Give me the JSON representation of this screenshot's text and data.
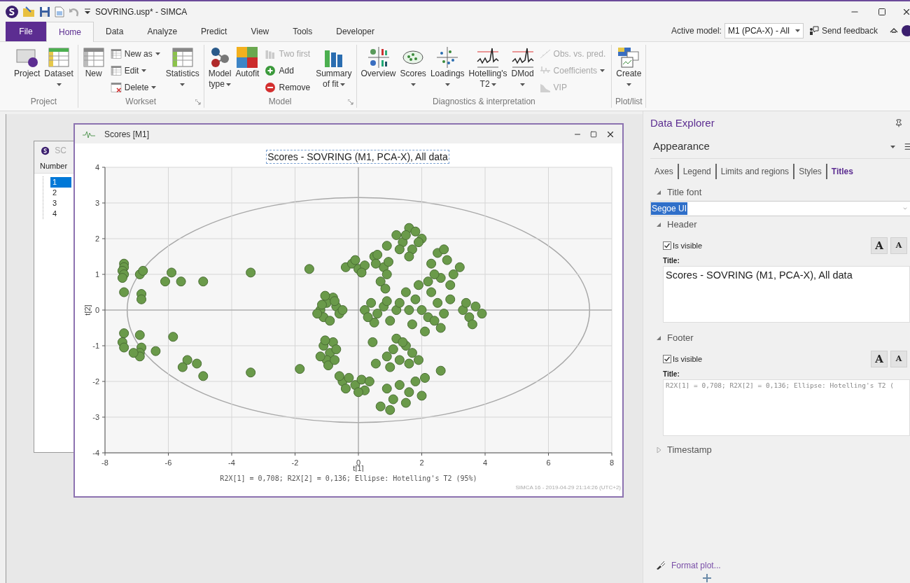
{
  "title_bar": {
    "title": "SOVRING.usp* - SIMCA"
  },
  "ribbon_tabs": [
    {
      "label": "File",
      "kind": "file",
      "selected": false
    },
    {
      "label": "Home",
      "kind": "tab",
      "selected": true
    },
    {
      "label": "Data",
      "kind": "tab",
      "selected": false
    },
    {
      "label": "Analyze",
      "kind": "tab",
      "selected": false
    },
    {
      "label": "Predict",
      "kind": "tab",
      "selected": false
    },
    {
      "label": "View",
      "kind": "tab",
      "selected": false
    },
    {
      "label": "Tools",
      "kind": "tab",
      "selected": false
    },
    {
      "label": "Developer",
      "kind": "tab",
      "selected": false
    }
  ],
  "active_model": {
    "label": "Active model:",
    "value": "M1 (PCA-X) - All"
  },
  "send_feedback": "Send feedback",
  "ribbon_groups": [
    {
      "label": "Project",
      "launcher": false,
      "items": [
        {
          "kind": "large",
          "lines": [
            "Project"
          ],
          "dropdown": false,
          "disabled": false
        },
        {
          "kind": "large",
          "lines": [
            "Dataset"
          ],
          "dropdown": true,
          "disabled": false
        }
      ]
    },
    {
      "label": "Workset",
      "launcher": true,
      "items": [
        {
          "kind": "large",
          "lines": [
            "New"
          ],
          "dropdown": false,
          "disabled": false
        },
        {
          "kind": "small",
          "lines": [
            "New as"
          ],
          "dropdown": true,
          "disabled": false
        },
        {
          "kind": "small",
          "lines": [
            "Edit"
          ],
          "dropdown": true,
          "disabled": false
        },
        {
          "kind": "small",
          "lines": [
            "Delete"
          ],
          "dropdown": true,
          "disabled": false
        },
        {
          "kind": "large",
          "lines": [
            "Statistics"
          ],
          "dropdown": true,
          "disabled": false
        }
      ]
    },
    {
      "label": "Model",
      "launcher": true,
      "items": [
        {
          "kind": "large",
          "lines": [
            "Model",
            "type"
          ],
          "dropdown": true,
          "disabled": false
        },
        {
          "kind": "large",
          "lines": [
            "Autofit"
          ],
          "dropdown": false,
          "disabled": false
        },
        {
          "kind": "small",
          "lines": [
            "Two first"
          ],
          "dropdown": false,
          "disabled": true
        },
        {
          "kind": "small",
          "lines": [
            "Add"
          ],
          "dropdown": false,
          "disabled": false
        },
        {
          "kind": "small",
          "lines": [
            "Remove"
          ],
          "dropdown": false,
          "disabled": false
        },
        {
          "kind": "large",
          "lines": [
            "Summary",
            "of fit"
          ],
          "dropdown": true,
          "disabled": false
        }
      ]
    },
    {
      "label": "Diagnostics & interpretation",
      "launcher": false,
      "items": [
        {
          "kind": "large",
          "lines": [
            "Overview"
          ],
          "dropdown": false,
          "disabled": false
        },
        {
          "kind": "large",
          "lines": [
            "Scores"
          ],
          "dropdown": true,
          "disabled": false
        },
        {
          "kind": "large",
          "lines": [
            "Loadings"
          ],
          "dropdown": true,
          "disabled": false
        },
        {
          "kind": "large",
          "lines": [
            "Hotelling's",
            "T2"
          ],
          "dropdown": true,
          "disabled": false
        },
        {
          "kind": "large",
          "lines": [
            "DMod"
          ],
          "dropdown": true,
          "disabled": false
        },
        {
          "kind": "small",
          "lines": [
            "Obs. vs. pred."
          ],
          "dropdown": false,
          "disabled": true
        },
        {
          "kind": "small",
          "lines": [
            "Coefficients"
          ],
          "dropdown": true,
          "disabled": true
        },
        {
          "kind": "small",
          "lines": [
            "VIP"
          ],
          "dropdown": false,
          "disabled": true
        }
      ]
    },
    {
      "label": "Plot/list",
      "launcher": false,
      "items": [
        {
          "kind": "large",
          "lines": [
            "Create"
          ],
          "dropdown": true,
          "disabled": false
        }
      ]
    }
  ],
  "workset_window": {
    "title": "SC",
    "column": "Number",
    "rows": [
      {
        "label": "1",
        "selected": true
      },
      {
        "label": "2",
        "selected": false
      },
      {
        "label": "3",
        "selected": false
      },
      {
        "label": "4",
        "selected": false
      }
    ]
  },
  "scores_window": {
    "title": "Scores [M1]",
    "chart_data": {
      "type": "scatter",
      "grid": true,
      "title": "Scores - SOVRING (M1, PCA-X), All data",
      "xlabel": "t[1]",
      "ylabel": "t[2]",
      "xlim": [
        -8,
        8
      ],
      "ylim": [
        -4,
        4
      ],
      "xticks": [
        -8,
        -6,
        -4,
        -2,
        0,
        2,
        4,
        6,
        8
      ],
      "yticks": [
        -4,
        -3,
        -2,
        -1,
        0,
        1,
        2,
        3,
        4
      ],
      "x": [
        -7.4,
        -7.4,
        -7.45,
        -7.4,
        -7.45,
        -7.4,
        -7.4,
        -7.45,
        -7.4,
        -6.9,
        -6.8,
        -6.85,
        -6.85,
        -6.9,
        -6.85,
        -6.9,
        -6.9,
        -7.1,
        -6.4,
        -6.1,
        -5.9,
        -5.6,
        -4.9,
        -5.85,
        -5.4,
        -5.55,
        -5.1,
        -4.9,
        -3.4,
        -3.4,
        -1.55,
        -1.85,
        -1.2,
        -1.1,
        -0.8,
        -1.0,
        -0.7,
        -1.3,
        -0.9,
        -0.75,
        -1.05,
        -0.6,
        -1.15,
        -1.1,
        -0.9,
        -1.0,
        -0.8,
        -1.2,
        -0.7,
        -0.95,
        -0.75,
        -1.05,
        -0.5,
        -0.3,
        -0.1,
        0.1,
        -0.4,
        0.2,
        0.35,
        -0.6,
        0.0,
        -0.4,
        -0.2,
        0.0,
        0.2,
        0.5,
        0.8,
        0.9,
        0.7,
        0.85,
        0.55,
        -0.1,
        0.6,
        0.95,
        0.1,
        0.2,
        0.4,
        0.6,
        0.8,
        1.0,
        1.2,
        0.5,
        0.9,
        0.3,
        1.3,
        1.2,
        1.4,
        1.6,
        1.8,
        2.0,
        1.7,
        1.5,
        1.9,
        1.3,
        1.6,
        2.3,
        2.5,
        2.8,
        3.0,
        2.6,
        2.4,
        3.2,
        2.7,
        2.9,
        2.2,
        1.5,
        1.8,
        2.0,
        2.2,
        1.7,
        2.5,
        2.7,
        2.3,
        1.9,
        2.9,
        2.6,
        1.6,
        2.1,
        2.4,
        3.3,
        3.5,
        3.7,
        3.9,
        3.6,
        3.4,
        0.9,
        1.1,
        1.3,
        1.5,
        1.7,
        1.2,
        1.9,
        1.0,
        1.6,
        1.4,
        0.9,
        1.1,
        0.7,
        1.3,
        1.6,
        1.8,
        2.0,
        1.0,
        1.5,
        2.1,
        0.9,
        0.45,
        0.55,
        2.6,
        -0.5
      ],
      "series": [
        {
          "color": "#6a9a4a",
          "values": [
            1.3,
            1.2,
            1.1,
            1.0,
            0.9,
            0.5,
            -0.65,
            -0.9,
            -1.05,
            1.0,
            1.1,
            0.45,
            0.3,
            -0.7,
            -1.05,
            -1.2,
            -1.3,
            -1.2,
            -1.15,
            0.8,
            1.05,
            0.8,
            0.8,
            -0.75,
            -1.4,
            -1.6,
            -1.5,
            -1.85,
            1.05,
            -1.75,
            1.15,
            -1.65,
            0.0,
            -0.2,
            0.35,
            0.2,
            0.1,
            -0.1,
            -0.3,
            0.25,
            0.4,
            -0.1,
            0.15,
            -1.0,
            -1.2,
            -1.4,
            -0.9,
            -1.3,
            -1.1,
            -1.55,
            -1.4,
            -0.85,
            -2.0,
            -1.9,
            -2.1,
            -1.95,
            -2.2,
            -2.25,
            -2.0,
            -1.85,
            -2.3,
            1.2,
            1.3,
            1.15,
            1.25,
            1.5,
            1.2,
            1.0,
            0.8,
            0.6,
            1.3,
            1.4,
            1.55,
            1.35,
            1.05,
            0.0,
            0.2,
            -0.1,
            0.1,
            -0.3,
            0.0,
            -0.35,
            0.25,
            -0.2,
            0.2,
            2.1,
            1.9,
            2.3,
            2.2,
            2.0,
            1.7,
            2.1,
            1.9,
            1.7,
            1.5,
            1.3,
            1.6,
            1.4,
            1.0,
            0.9,
            1.0,
            1.2,
            1.7,
            0.7,
            0.8,
            0.5,
            0.3,
            0.0,
            -0.2,
            -0.4,
            0.2,
            -0.1,
            0.5,
            0.7,
            0.3,
            -0.5,
            0.0,
            -0.6,
            -0.3,
            0.0,
            -0.2,
            0.1,
            -0.1,
            -0.4,
            0.2,
            -1.3,
            -1.1,
            -1.4,
            -1.0,
            -1.2,
            -0.8,
            -1.4,
            -1.6,
            -1.5,
            -0.9,
            -2.2,
            -2.5,
            -2.7,
            -2.1,
            -2.3,
            -2.0,
            -2.4,
            -2.8,
            -2.6,
            -1.9,
            1.8,
            -0.9,
            -1.5,
            -1.7,
            0.0
          ]
        }
      ]
    },
    "footer": "R2X[1] = 0,708; R2X[2] = 0,136; Ellipse: Hotelling's T2 (95%)",
    "timestamp": "SIMCA 16 - 2019-04-29 21:14:26 (UTC+2)"
  },
  "data_explorer": {
    "title": "Data Explorer",
    "section": "Appearance",
    "tabs": [
      {
        "label": "Axes",
        "selected": false
      },
      {
        "label": "Legend",
        "selected": false
      },
      {
        "label": "Limits and regions",
        "selected": false
      },
      {
        "label": "Styles",
        "selected": false
      },
      {
        "label": "Titles",
        "selected": true
      }
    ],
    "title_font": {
      "label": "Title font",
      "expanded": true,
      "value": "Segoe UI"
    },
    "header": {
      "label": "Header",
      "expanded": true,
      "visible_label": "Is visible",
      "checked": true,
      "size_buttons": [
        "A",
        "A"
      ],
      "title_label": "Title:",
      "title_value": "Scores - SOVRING (M1, PCA-X), All data"
    },
    "footer": {
      "label": "Footer",
      "expanded": true,
      "visible_label": "Is visible",
      "checked": true,
      "size_buttons": [
        "A",
        "A"
      ],
      "title_label": "Title:",
      "title_value": "R2X[1] = 0,708; R2X[2] = 0,136; Ellipse: Hotelling's T2 ("
    },
    "timestamp": {
      "label": "Timestamp",
      "expanded": false
    },
    "format_plot": "Format plot..."
  }
}
